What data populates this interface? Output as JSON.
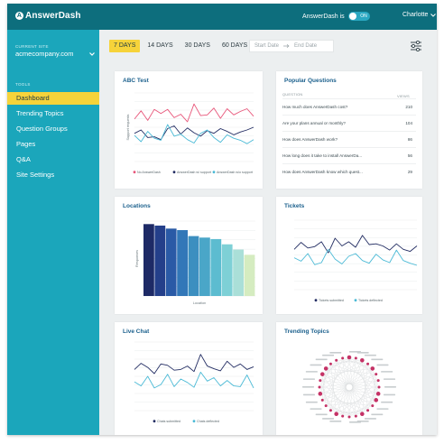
{
  "header": {
    "logo_text": "AnswerDash",
    "toggle_label": "AnswerDash is",
    "toggle_state": "ON",
    "user_name": "Charlotte"
  },
  "sidebar": {
    "site_label": "CURRENT SITE",
    "site_value": "acmecompany.com",
    "tools_label": "TOOLS",
    "items": [
      {
        "label": "Dashboard",
        "active": true
      },
      {
        "label": "Trending Topics",
        "active": false
      },
      {
        "label": "Question Groups",
        "active": false
      },
      {
        "label": "Pages",
        "active": false
      },
      {
        "label": "Q&A",
        "active": false
      },
      {
        "label": "Site Settings",
        "active": false
      }
    ]
  },
  "toolbar": {
    "ranges": [
      "7 DAYS",
      "14 DAYS",
      "30 DAYS",
      "60 DAYS"
    ],
    "active_range": "7 DAYS",
    "start_placeholder": "Start Date",
    "end_placeholder": "End Date"
  },
  "colors": {
    "header": "#0d6e7d",
    "sidebar": "#1ba6bb",
    "accent_yellow": "#f6d33a",
    "card_title": "#1a5f8c",
    "series_pink": "#e8567a",
    "series_navy": "#232d63",
    "series_cyan": "#4bbad6"
  },
  "cards": {
    "abc_test": {
      "title": "ABC Test"
    },
    "popular": {
      "title": "Popular Questions",
      "col_question": "QUESTION",
      "col_views": "VIEWS",
      "rows": [
        {
          "question": "How much does AnswerDash cost?",
          "views": "210"
        },
        {
          "question": "Are your plans annual or monthly?",
          "views": "104"
        },
        {
          "question": "How does AnswerDash work?",
          "views": "86"
        },
        {
          "question": "How long does it take to install AnswerDa...",
          "views": "56"
        },
        {
          "question": "How does AnswerDash know which quest...",
          "views": "29"
        }
      ]
    },
    "locations": {
      "title": "Locations"
    },
    "tickets": {
      "title": "Tickets"
    },
    "live_chat": {
      "title": "Live Chat"
    },
    "trending": {
      "title": "Trending Topics"
    }
  },
  "chart_data": [
    {
      "type": "line",
      "title": "ABC Test",
      "ylabel": "Support requests",
      "ylim": [
        0,
        10
      ],
      "grid": true,
      "legend": "bottom",
      "x": [
        1,
        2,
        3,
        4,
        5,
        6,
        7,
        8,
        9,
        10,
        11,
        12,
        13,
        14,
        15,
        16,
        17,
        18,
        19
      ],
      "series": [
        {
          "name": "No AnswerDash",
          "color": "#e8567a",
          "values": [
            6.2,
            7.4,
            6.0,
            7.6,
            7.0,
            7.6,
            6.4,
            6.9,
            5.8,
            8.4,
            6.7,
            6.8,
            7.8,
            6.3,
            7.7,
            6.8,
            7.3,
            7.7,
            6.6
          ]
        },
        {
          "name": "AnswerDash w/ support",
          "color": "#232d63",
          "values": [
            4.1,
            4.6,
            3.5,
            3.6,
            3.2,
            4.8,
            5.2,
            4.0,
            4.9,
            4.2,
            3.7,
            4.5,
            4.1,
            4.8,
            4.4,
            3.9,
            4.3,
            4.6,
            5.0
          ]
        },
        {
          "name": "AnswerDash w/o support",
          "color": "#4bbad6",
          "values": [
            3.8,
            2.9,
            4.4,
            3.4,
            3.1,
            5.4,
            3.7,
            4.0,
            3.2,
            2.7,
            4.1,
            4.6,
            3.5,
            2.8,
            3.9,
            3.4,
            3.1,
            2.6,
            3.2
          ]
        }
      ]
    },
    {
      "type": "bar",
      "title": "Locations",
      "xlabel": "Location",
      "ylabel": "Responses",
      "ylim": [
        0,
        10
      ],
      "grid": true,
      "categories": [
        "",
        "",
        "",
        "",
        "",
        "",
        "",
        "",
        "",
        ""
      ],
      "values": [
        9.6,
        9.4,
        9.0,
        8.8,
        8.0,
        7.8,
        7.6,
        6.9,
        6.2,
        5.5
      ],
      "colors": [
        "#1e2a66",
        "#243f8a",
        "#2a5aa6",
        "#3277b8",
        "#3c8fc0",
        "#4aa6c8",
        "#5cbcd0",
        "#7ed0d6",
        "#aadfd8",
        "#d5ecc0"
      ]
    },
    {
      "type": "line",
      "title": "Tickets",
      "ylim": [
        0,
        10
      ],
      "grid": true,
      "legend": "bottom",
      "x": [
        1,
        2,
        3,
        4,
        5,
        6,
        7,
        8,
        9,
        10,
        11,
        12,
        13,
        14,
        15,
        16,
        17,
        18,
        19
      ],
      "series": [
        {
          "name": "Tickets submitted",
          "color": "#232d63",
          "values": [
            5.8,
            6.8,
            6.0,
            6.2,
            6.9,
            5.3,
            7.4,
            6.3,
            6.9,
            6.1,
            7.8,
            6.5,
            6.6,
            6.3,
            5.7,
            6.6,
            5.8,
            5.5,
            6.3
          ]
        },
        {
          "name": "Tickets deflected",
          "color": "#4bbad6",
          "values": [
            4.6,
            4.1,
            5.2,
            3.6,
            3.9,
            5.8,
            4.4,
            3.7,
            4.8,
            5.2,
            4.2,
            3.8,
            5.1,
            4.3,
            3.9,
            5.7,
            4.2,
            3.8,
            3.5
          ]
        }
      ]
    },
    {
      "type": "line",
      "title": "Live Chat",
      "ylim": [
        0,
        10
      ],
      "grid": true,
      "legend": "bottom",
      "x": [
        1,
        2,
        3,
        4,
        5,
        6,
        7,
        8,
        9,
        10,
        11,
        12,
        13,
        14,
        15,
        16,
        17,
        18,
        19
      ],
      "series": [
        {
          "name": "Chats submitted",
          "color": "#232d63",
          "values": [
            6.0,
            6.9,
            6.3,
            5.4,
            6.8,
            6.6,
            5.9,
            6.0,
            6.5,
            5.7,
            8.2,
            6.5,
            6.1,
            5.8,
            7.2,
            6.3,
            6.8,
            6.0,
            6.4
          ]
        },
        {
          "name": "Chats deflected",
          "color": "#4bbad6",
          "values": [
            4.2,
            3.6,
            5.0,
            3.3,
            3.8,
            5.3,
            3.5,
            4.6,
            4.1,
            3.4,
            5.6,
            4.3,
            4.8,
            3.6,
            4.4,
            3.6,
            3.5,
            5.2,
            3.3
          ]
        }
      ]
    }
  ]
}
